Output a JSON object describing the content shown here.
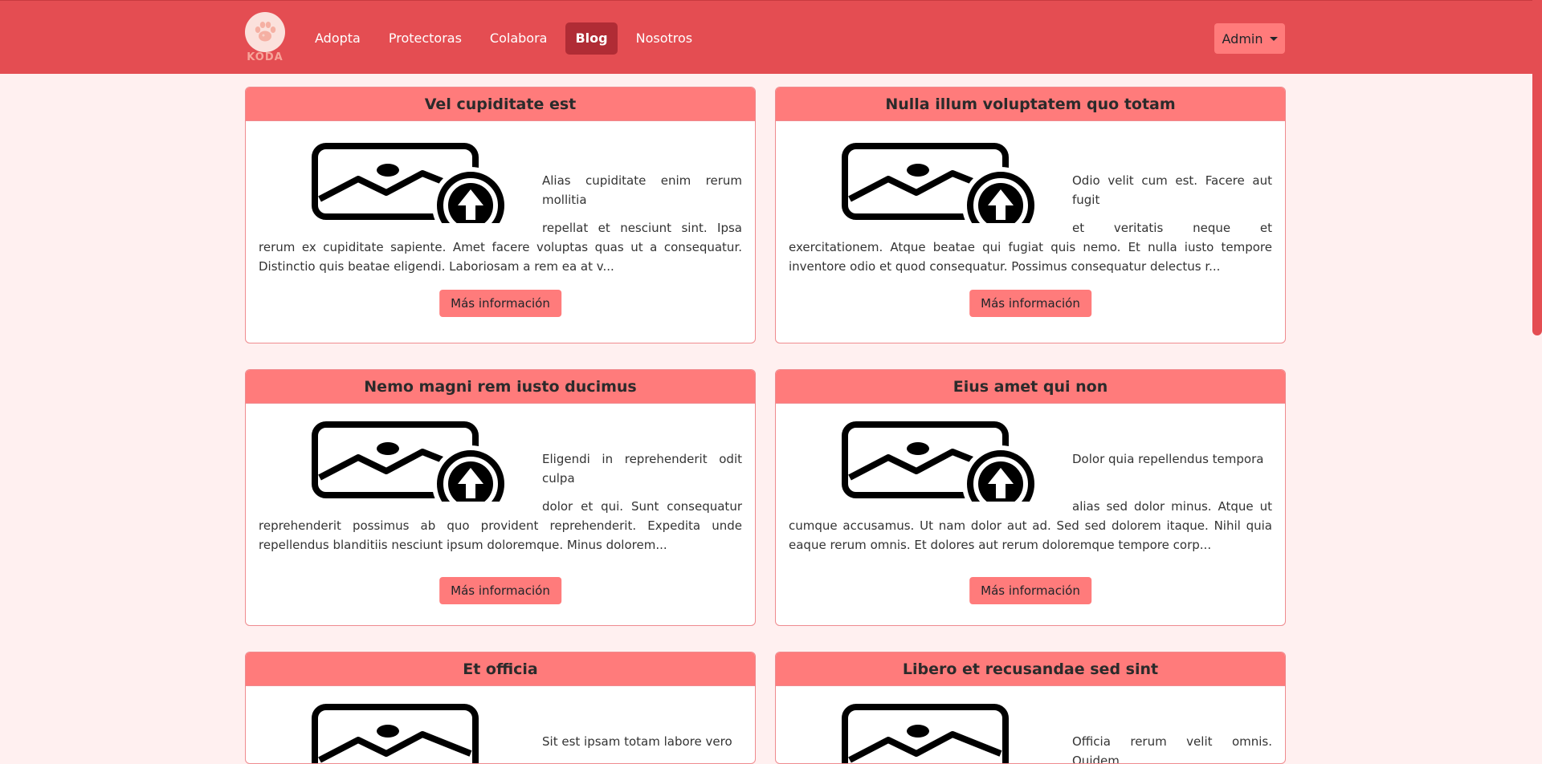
{
  "nav": {
    "logo_text": "KODA",
    "links": [
      {
        "label": "Adopta",
        "active": false
      },
      {
        "label": "Protectoras",
        "active": false
      },
      {
        "label": "Colabora",
        "active": false
      },
      {
        "label": "Blog",
        "active": true
      },
      {
        "label": "Nosotros",
        "active": false
      }
    ],
    "admin_label": "Admin"
  },
  "colors": {
    "primary": "#e44d52",
    "card_header": "#ff7b7b",
    "active": "#b02c35",
    "background": "#fff0f0"
  },
  "cards": [
    {
      "title": "Vel cupiditate est",
      "text_first": "Alias cupiditate enim rerum mollitia",
      "text_rest": "repellat et nesciunt sint. Ipsa rerum ex cupiditate sapiente. Amet facere voluptas quas ut a consequatur. Distinctio quis beatae eligendi. Laboriosam a rem ea at v...",
      "button": "Más información",
      "icon": "image-upload-icon"
    },
    {
      "title": "Nulla illum voluptatem quo totam",
      "text_first": "Odio velit cum est. Facere aut fugit",
      "text_rest": "et veritatis neque et exercitationem. Atque beatae qui fugiat quis nemo. Et nulla iusto tempore inventore odio et quod consequatur. Possimus consequatur delectus r...",
      "button": "Más información",
      "icon": "image-upload-icon"
    },
    {
      "title": "Nemo magni rem iusto ducimus",
      "text_first": "Eligendi in reprehenderit odit culpa",
      "text_rest": "dolor et qui. Sunt consequatur reprehenderit possimus ab quo provident reprehenderit. Expedita unde repellendus blanditiis nesciunt ipsum doloremque. Minus dolorem...",
      "button": "Más información",
      "icon": "image-upload-icon"
    },
    {
      "title": "Eius amet qui non",
      "text_first": "Dolor quia repellendus tempora",
      "text_rest": "alias sed dolor minus. Atque ut cumque accusamus. Ut nam dolor aut ad. Sed sed dolorem itaque. Nihil quia eaque rerum omnis. Et dolores aut rerum doloremque tempore corp...",
      "button": "Más información",
      "icon": "image-upload-icon"
    },
    {
      "title": "Et officia",
      "text_first": "Sit est ipsam totam labore vero",
      "text_rest": "",
      "button": "",
      "icon": "image-upload-icon"
    },
    {
      "title": "Libero et recusandae sed sint",
      "text_first": "Officia rerum velit omnis. Quidem",
      "text_rest": "",
      "button": "",
      "icon": "image-upload-icon"
    }
  ]
}
